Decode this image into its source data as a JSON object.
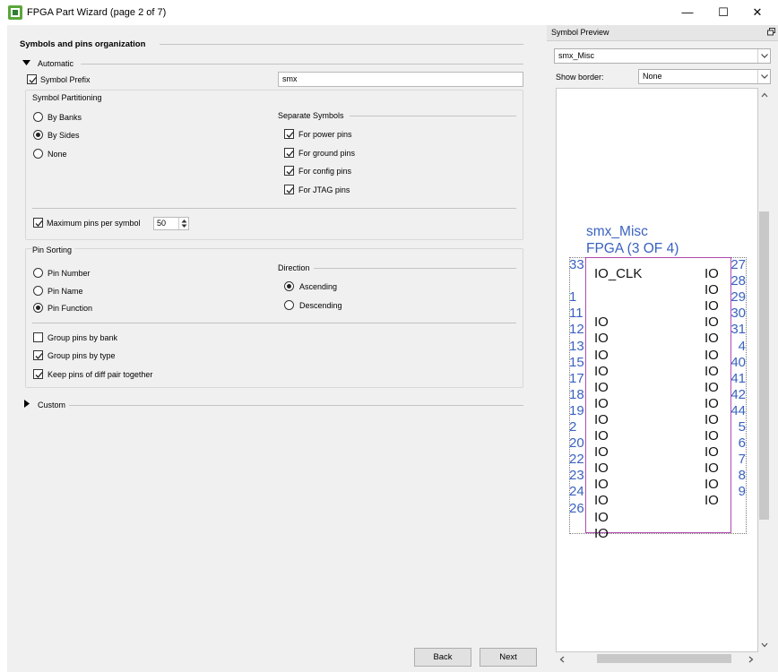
{
  "window": {
    "title": "FPGA Part Wizard (page 2 of 7)",
    "controls": {
      "minimize": "—",
      "maximize": "☐",
      "close": "✕"
    }
  },
  "main": {
    "section_title": "Symbols and pins organization",
    "automatic_label": "Automatic",
    "symbol_prefix": {
      "label": "Symbol Prefix",
      "checked": true,
      "value": "smx"
    },
    "partitioning": {
      "title": "Symbol Partitioning",
      "options": [
        {
          "label": "By Banks",
          "selected": false
        },
        {
          "label": "By Sides",
          "selected": true
        },
        {
          "label": "None",
          "selected": false
        }
      ],
      "separate_title": "Separate Symbols",
      "separate": [
        {
          "label": "For power pins",
          "checked": true
        },
        {
          "label": "For ground pins",
          "checked": true
        },
        {
          "label": "For config pins",
          "checked": true
        },
        {
          "label": "For JTAG pins",
          "checked": true
        }
      ],
      "max_pins": {
        "label": "Maximum pins per symbol",
        "checked": true,
        "value": "50"
      }
    },
    "sorting": {
      "title": "Pin Sorting",
      "options": [
        {
          "label": "Pin Number",
          "selected": false
        },
        {
          "label": "Pin Name",
          "selected": false
        },
        {
          "label": "Pin Function",
          "selected": true
        }
      ],
      "direction_title": "Direction",
      "direction": [
        {
          "label": "Ascending",
          "selected": true
        },
        {
          "label": "Descending",
          "selected": false
        }
      ],
      "extra": [
        {
          "label": "Group pins by bank",
          "checked": false
        },
        {
          "label": "Group pins by type",
          "checked": true
        },
        {
          "label": "Keep pins of diff pair together",
          "checked": true
        }
      ]
    },
    "custom_label": "Custom"
  },
  "footer": {
    "back": "Back",
    "next": "Next"
  },
  "preview": {
    "title": "Symbol Preview",
    "symbol_select": "smx_Misc",
    "border_label": "Show border:",
    "border_select": "None",
    "symbol": {
      "name": "smx_Misc",
      "subtitle": "FPGA (3 OF 4)",
      "left_pins": [
        {
          "num": "33",
          "name": "IO_CLK"
        },
        {
          "num": "",
          "name": ""
        },
        {
          "num": "1",
          "name": ""
        },
        {
          "num": "11",
          "name": "IO"
        },
        {
          "num": "12",
          "name": "IO"
        },
        {
          "num": "13",
          "name": "IO"
        },
        {
          "num": "15",
          "name": "IO"
        },
        {
          "num": "17",
          "name": "IO"
        },
        {
          "num": "18",
          "name": "IO"
        },
        {
          "num": "19",
          "name": "IO"
        },
        {
          "num": "2",
          "name": "IO"
        },
        {
          "num": "20",
          "name": "IO"
        },
        {
          "num": "22",
          "name": "IO"
        },
        {
          "num": "23",
          "name": "IO"
        },
        {
          "num": "24",
          "name": "IO"
        },
        {
          "num": "26",
          "name": "IO"
        },
        {
          "num": "",
          "name": "IO"
        }
      ],
      "right_pins": [
        {
          "num": "27",
          "name": "IO"
        },
        {
          "num": "28",
          "name": "IO"
        },
        {
          "num": "29",
          "name": "IO"
        },
        {
          "num": "30",
          "name": "IO"
        },
        {
          "num": "31",
          "name": "IO"
        },
        {
          "num": "4",
          "name": "IO"
        },
        {
          "num": "40",
          "name": "IO"
        },
        {
          "num": "41",
          "name": "IO"
        },
        {
          "num": "42",
          "name": "IO"
        },
        {
          "num": "44",
          "name": "IO"
        },
        {
          "num": "5",
          "name": "IO"
        },
        {
          "num": "6",
          "name": "IO"
        },
        {
          "num": "7",
          "name": "IO"
        },
        {
          "num": "8",
          "name": "IO"
        },
        {
          "num": "9",
          "name": "IO"
        }
      ]
    }
  },
  "colors": {
    "pin_number": "#3a62c0",
    "symbol_border": "#b04ab0",
    "selection_blue": "#3a62c0"
  }
}
